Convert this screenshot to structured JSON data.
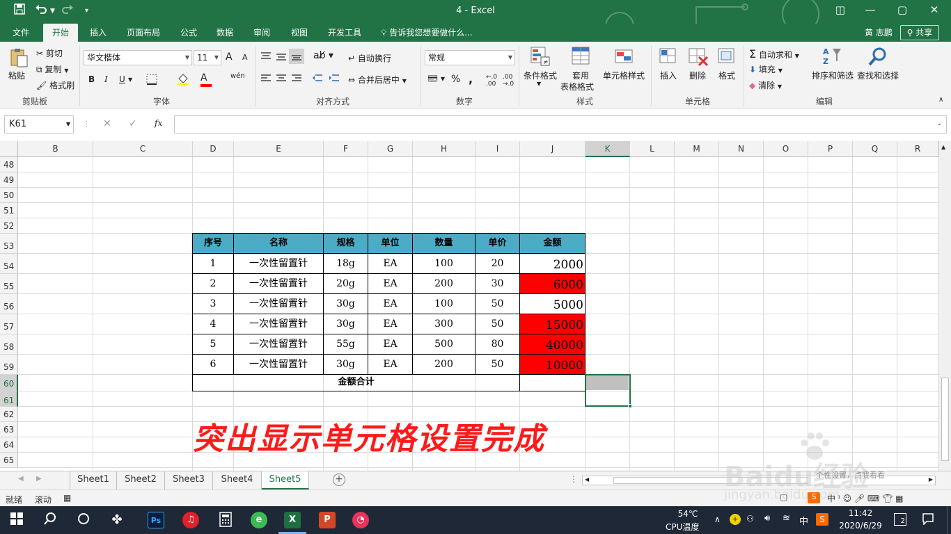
{
  "titlebar": {
    "title": "4  -  Excel",
    "save_icon": "save-icon",
    "undo_icon": "undo-icon",
    "redo_icon": "redo-icon",
    "minimize": "—",
    "maximize": "▢",
    "close": "✕",
    "ribbon_display": "◫"
  },
  "tabs": [
    {
      "label": "文件"
    },
    {
      "label": "开始"
    },
    {
      "label": "插入"
    },
    {
      "label": "页面布局"
    },
    {
      "label": "公式"
    },
    {
      "label": "数据"
    },
    {
      "label": "审阅"
    },
    {
      "label": "视图"
    },
    {
      "label": "开发工具"
    }
  ],
  "tell_me": "告诉我您想要做什么...",
  "user_name": "黄 志鹏",
  "share_label": "共享",
  "ribbon": {
    "clipboard": {
      "paste": "粘贴",
      "cut": "剪切",
      "copy": "复制",
      "format_painter": "格式刷",
      "label": "剪贴板"
    },
    "font": {
      "name": "华文楷体",
      "size": "11",
      "bold": "B",
      "italic": "I",
      "underline": "U",
      "grow": "A",
      "shrink": "A",
      "phonetic": "wén",
      "label": "字体",
      "font_color": "A"
    },
    "alignment": {
      "wrap": "自动换行",
      "merge": "合并后居中",
      "label": "对齐方式"
    },
    "number": {
      "format": "常规",
      "percent": "%",
      "comma": ",",
      "label": "数字"
    },
    "styles": {
      "conditional": "条件格式",
      "table1": "套用",
      "table2": "表格格式",
      "cell_styles": "单元格样式",
      "label": "样式"
    },
    "cells": {
      "insert": "插入",
      "delete": "删除",
      "format": "格式",
      "label": "单元格"
    },
    "editing": {
      "autosum": "自动求和",
      "fill": "填充",
      "clear": "清除",
      "sort": "排序和筛选",
      "find": "查找和选择",
      "label": "编辑"
    }
  },
  "formula_bar": {
    "name_box": "K61",
    "cancel": "✕",
    "enter": "✓",
    "fx": "fx",
    "value": ""
  },
  "columns": [
    "B",
    "C",
    "D",
    "E",
    "F",
    "G",
    "H",
    "I",
    "J",
    "K",
    "L",
    "M",
    "N",
    "O",
    "P",
    "Q",
    "R"
  ],
  "rows": [
    "48",
    "49",
    "50",
    "51",
    "52",
    "53",
    "54",
    "55",
    "56",
    "57",
    "58",
    "59",
    "60",
    "61",
    "62",
    "63",
    "64",
    "65"
  ],
  "table": {
    "headers": [
      "序号",
      "名称",
      "规格",
      "单位",
      "数量",
      "单价",
      "金额"
    ],
    "rows": [
      {
        "no": "1",
        "name": "一次性留置针",
        "spec": "18g",
        "unit": "EA",
        "qty": "100",
        "price": "20",
        "amount": "2000",
        "highlight": false
      },
      {
        "no": "2",
        "name": "一次性留置针",
        "spec": "20g",
        "unit": "EA",
        "qty": "200",
        "price": "30",
        "amount": "6000",
        "highlight": true
      },
      {
        "no": "3",
        "name": "一次性留置针",
        "spec": "30g",
        "unit": "EA",
        "qty": "100",
        "price": "50",
        "amount": "5000",
        "highlight": false
      },
      {
        "no": "4",
        "name": "一次性留置针",
        "spec": "30g",
        "unit": "EA",
        "qty": "300",
        "price": "50",
        "amount": "15000",
        "highlight": true
      },
      {
        "no": "5",
        "name": "一次性留置针",
        "spec": "55g",
        "unit": "EA",
        "qty": "500",
        "price": "80",
        "amount": "40000",
        "highlight": true
      },
      {
        "no": "6",
        "name": "一次性留置针",
        "spec": "30g",
        "unit": "EA",
        "qty": "200",
        "price": "50",
        "amount": "10000",
        "highlight": true
      }
    ],
    "total_label": "金额合计",
    "highlight_color": "#ff0000",
    "header_color": "#4bacc6"
  },
  "caption": "突出显示单元格设置完成",
  "sheets": [
    {
      "label": "Sheet1"
    },
    {
      "label": "Sheet2"
    },
    {
      "label": "Sheet3"
    },
    {
      "label": "Sheet4"
    },
    {
      "label": "Sheet5"
    }
  ],
  "status": {
    "ready": "就绪",
    "scroll": "滚动"
  },
  "watermark": {
    "brand": "Baidu经验",
    "url": "jingyan.baidu.com",
    "text": "个性设置，点我看看"
  },
  "taskbar": {
    "temp": "54℃",
    "cpu_label": "CPU温度",
    "ime": "中",
    "time": "11:42",
    "date": "2020/6/29",
    "notif_count": "2"
  },
  "accent_color": "#217346"
}
